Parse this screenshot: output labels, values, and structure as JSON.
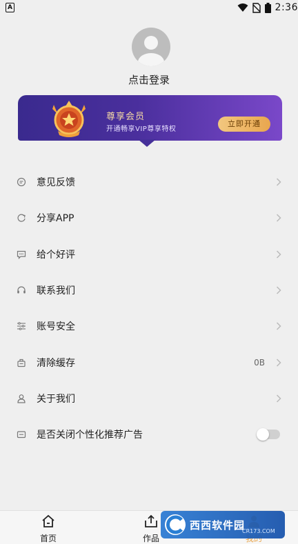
{
  "status_bar": {
    "left_icon_letter": "A",
    "time": "2:36"
  },
  "profile": {
    "login_label": "点击登录"
  },
  "vip": {
    "title": "尊享会员",
    "subtitle": "开通畅享VIP尊享特权",
    "button_label": "立即开通",
    "colors": {
      "banner_start": "#3a2a8e",
      "banner_end": "#7a48c9",
      "button": "#e9a64e"
    }
  },
  "menu": {
    "items": [
      {
        "label": "意见反馈",
        "icon": "feedback-icon"
      },
      {
        "label": "分享APP",
        "icon": "share-icon"
      },
      {
        "label": "给个好评",
        "icon": "rate-icon"
      },
      {
        "label": "联系我们",
        "icon": "headset-icon"
      },
      {
        "label": "账号安全",
        "icon": "sliders-icon"
      },
      {
        "label": "清除缓存",
        "icon": "clear-cache-icon",
        "value": "0B"
      },
      {
        "label": "关于我们",
        "icon": "about-icon"
      },
      {
        "label": "是否关闭个性化推荐广告",
        "icon": "ad-icon",
        "toggle": false
      }
    ]
  },
  "tabbar": {
    "tabs": [
      {
        "label": "首页",
        "icon": "home-icon"
      },
      {
        "label": "作品",
        "icon": "upload-icon"
      },
      {
        "label": "我的",
        "icon": "profile-icon",
        "active": true
      }
    ]
  },
  "watermark": {
    "brand": "西西软件园",
    "url": "CR173.COM"
  }
}
